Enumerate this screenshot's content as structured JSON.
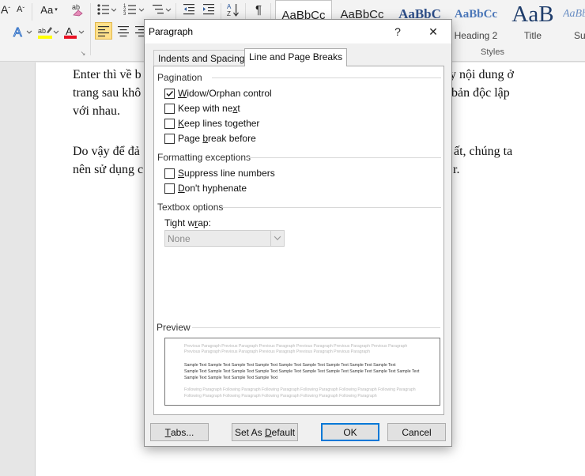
{
  "ribbon": {
    "font_row": [
      "A",
      "A",
      "Aa",
      "ab"
    ],
    "styles": [
      {
        "sample": "AaBbCc",
        "name": ""
      },
      {
        "sample": "AaBbCc",
        "name": ""
      },
      {
        "sample": "AaBbC",
        "name": ""
      },
      {
        "sample": "AaBbCc",
        "name": "Heading 2"
      },
      {
        "sample": "AaB",
        "name": "Title"
      },
      {
        "sample": "AaBbC",
        "name": "Su"
      }
    ],
    "styles_group_label": "Styles",
    "text_color_hex": "#e81123",
    "highlight_color_hex": "#ffff00"
  },
  "document": {
    "para1": [
      "Enter thì về b",
      "trang sau khô",
      "với nhau."
    ],
    "para1_right": [
      "y nội dung ở",
      "bản độc lập"
    ],
    "para2": [
      "Do vậy để đả",
      "nên sử dụng c"
    ],
    "para2_right": [
      "ất, chúng ta",
      "r."
    ]
  },
  "dialog": {
    "title": "Paragraph",
    "help_glyph": "?",
    "close_glyph": "✕",
    "tabs": [
      "Indents and Spacing",
      "Line and Page Breaks"
    ],
    "active_tab": 1,
    "pagination": {
      "label": "Pagination",
      "options": [
        {
          "pre": "",
          "key": "W",
          "post": "idow/Orphan control",
          "checked": true
        },
        {
          "pre": "Keep with ne",
          "key": "x",
          "post": "t",
          "checked": false
        },
        {
          "pre": "",
          "key": "K",
          "post": "eep lines together",
          "checked": false
        },
        {
          "pre": "Page ",
          "key": "b",
          "post": "reak before",
          "checked": false
        }
      ]
    },
    "formatting": {
      "label": "Formatting exceptions",
      "options": [
        {
          "pre": "",
          "key": "S",
          "post": "uppress line numbers",
          "checked": false
        },
        {
          "pre": "",
          "key": "D",
          "post": "on't hyphenate",
          "checked": false
        }
      ]
    },
    "textbox": {
      "label": "Textbox options",
      "wrap_pre": "Tight w",
      "wrap_key": "r",
      "wrap_post": "ap:",
      "wrap_value": "None"
    },
    "preview": {
      "label": "Preview",
      "previous_lines": [
        "Previous Paragraph Previous Paragraph Previous Paragraph Previous Paragraph Previous Paragraph Previous Paragraph",
        "Previous Paragraph Previous Paragraph Previous Paragraph Previous Paragraph Previous Paragraph"
      ],
      "sample_lines": [
        "Sample Text Sample Text Sample Text Sample Text Sample Text Sample Text Sample Text Sample Text Sample Text",
        "Sample Text Sample Text Sample Text Sample Text Sample Text Sample Text Sample Text Sample Text Sample Text Sample Text",
        "Sample Text Sample Text Sample Text Sample Text"
      ],
      "following_lines": [
        "Following Paragraph Following Paragraph Following Paragraph Following Paragraph Following Paragraph Following Paragraph",
        "Following Paragraph Following Paragraph Following Paragraph Following Paragraph Following Paragraph"
      ]
    },
    "buttons": {
      "tabs_key": "T",
      "tabs_post": "abs...",
      "set_default_pre": "Set As ",
      "set_default_key": "D",
      "set_default_post": "efault",
      "ok": "OK",
      "cancel": "Cancel"
    }
  }
}
